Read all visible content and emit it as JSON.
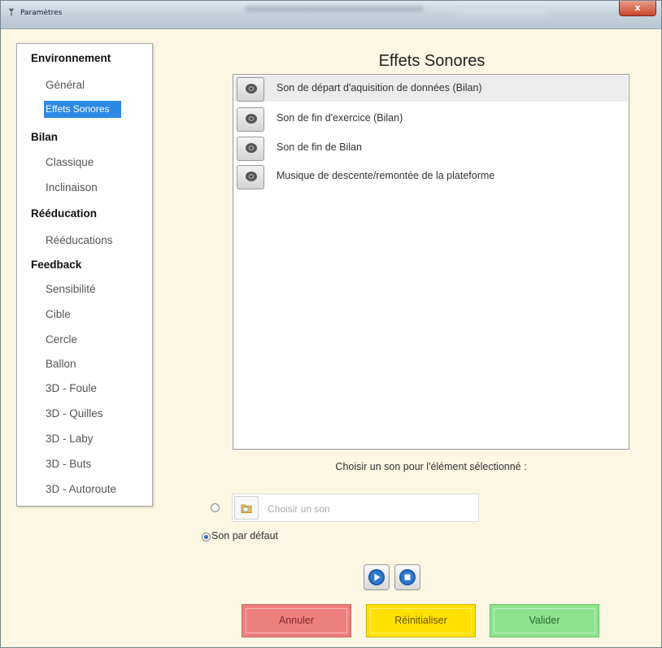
{
  "window": {
    "title": "Paramètres",
    "app_icon": "ᛘ",
    "close_label": "x"
  },
  "sidebar": {
    "items": [
      {
        "label": "Environnement",
        "kind": "category"
      },
      {
        "label": "Général",
        "kind": "item"
      },
      {
        "label": "Effets Sonores",
        "kind": "item",
        "selected": true
      },
      {
        "label": "Bilan",
        "kind": "category"
      },
      {
        "label": "Classique",
        "kind": "item"
      },
      {
        "label": "Inclinaison",
        "kind": "item"
      },
      {
        "label": "Rééducation",
        "kind": "category"
      },
      {
        "label": "Rééducations",
        "kind": "item"
      },
      {
        "label": "Feedback",
        "kind": "category"
      },
      {
        "label": "Sensibilité",
        "kind": "item"
      },
      {
        "label": "Cible",
        "kind": "item"
      },
      {
        "label": "Cercle",
        "kind": "item"
      },
      {
        "label": "Ballon",
        "kind": "item"
      },
      {
        "label": "3D - Foule",
        "kind": "item"
      },
      {
        "label": "3D - Quilles",
        "kind": "item"
      },
      {
        "label": "3D - Laby",
        "kind": "item"
      },
      {
        "label": "3D - Buts",
        "kind": "item"
      },
      {
        "label": "3D - Autoroute",
        "kind": "item"
      }
    ]
  },
  "main": {
    "title": "Effets Sonores",
    "sounds": [
      {
        "label": "Son de départ d'aquisition de données (Bilan)",
        "icon": "speaker-icon"
      },
      {
        "label": "Son de fin d'exercice (Bilan)",
        "icon": "speaker-icon"
      },
      {
        "label": "Son de fin de Bilan",
        "icon": "speaker-icon"
      },
      {
        "label": "Musique de descente/remontée de la plateforme",
        "icon": "speaker-icon"
      }
    ],
    "choose_label": "Choisir un son pour l'élément sélectionné :",
    "custom_sound_placeholder": "Choisir un son",
    "default_sound_label": "Son par défaut",
    "selected_option": "Son par défaut"
  },
  "buttons": {
    "cancel": "Annuler",
    "reset": "Réinitialiser",
    "ok": "Valider"
  },
  "colors": {
    "selection": "#2d8ae4",
    "cancel": "#ee7f7f",
    "reset": "#ffe000",
    "ok": "#8ee28e",
    "background": "#fbf7e2"
  }
}
